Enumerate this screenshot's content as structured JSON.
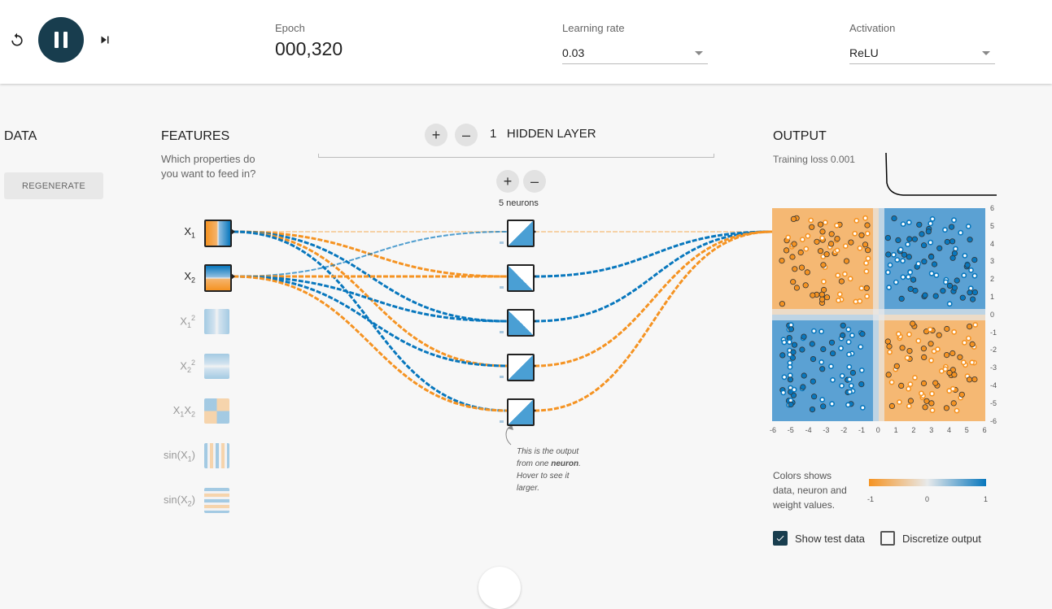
{
  "controls": {
    "epoch_label": "Epoch",
    "epoch_value": "000,320",
    "learning_rate_label": "Learning rate",
    "learning_rate_value": "0.03",
    "activation_label": "Activation",
    "activation_value": "ReLU",
    "icons": {
      "reset": "reset-icon",
      "play": "pause-icon",
      "step": "step-icon"
    },
    "state": "playing"
  },
  "data_panel": {
    "title": "DATA",
    "regenerate_label": "REGENERATE"
  },
  "features_panel": {
    "title": "FEATURES",
    "subtitle_line1": "Which properties do",
    "subtitle_line2": "you want to feed in?",
    "features": [
      {
        "label": "X",
        "sub": "1",
        "sup": "",
        "active": true
      },
      {
        "label": "X",
        "sub": "2",
        "sup": "",
        "active": true
      },
      {
        "label": "X",
        "sub": "1",
        "sup": "2",
        "active": false
      },
      {
        "label": "X",
        "sub": "2",
        "sup": "2",
        "active": false
      },
      {
        "label": "X1X2",
        "sub": "",
        "sup": "",
        "active": false
      },
      {
        "label": "sin(X1)",
        "sub": "",
        "sup": "",
        "active": false
      },
      {
        "label": "sin(X2)",
        "sub": "",
        "sup": "",
        "active": false
      }
    ]
  },
  "hidden_layers": {
    "count": "1",
    "label": "HIDDEN LAYER",
    "neurons_label": "5 neurons",
    "neuron_count": 5,
    "annotation_line1": "This is the output",
    "annotation_line2a": "from one ",
    "annotation_bold": "neuron",
    "annotation_line2b": ".",
    "annotation_line3": "Hover to see it",
    "annotation_line4": "larger."
  },
  "output_panel": {
    "title": "OUTPUT",
    "training_loss_label": "Training loss 0.001",
    "axis_ticks": [
      "-6",
      "-5",
      "-4",
      "-3",
      "-2",
      "-1",
      "0",
      "1",
      "2",
      "3",
      "4",
      "5",
      "6"
    ],
    "legend_line1": "Colors shows",
    "legend_line2": "data, neuron and",
    "legend_line3": "weight values.",
    "colorbar_min": "-1",
    "colorbar_mid": "0",
    "colorbar_max": "1",
    "show_test_data_label": "Show test data",
    "show_test_data_checked": true,
    "discretize_label": "Discretize output",
    "discretize_checked": false
  },
  "colors": {
    "orange": "#f59322",
    "blue": "#0877bd",
    "dark": "#183d4e",
    "neutral": "#e8eaeb"
  }
}
